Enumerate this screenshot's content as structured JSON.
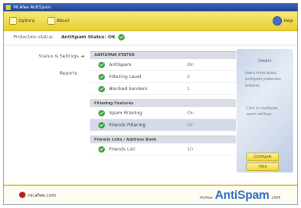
{
  "window": {
    "title": "McAfee AntiSpam"
  },
  "toolbar": {
    "items": [
      {
        "icon": "options-icon",
        "label": "Options"
      },
      {
        "icon": "about-icon",
        "label": "About"
      }
    ],
    "help_label": "Help"
  },
  "status": {
    "prefix": "Protection status:",
    "label": "AntiSpam Status: OK"
  },
  "nav": {
    "items": [
      {
        "label": "Status & Settings",
        "arrow": "◄"
      },
      {
        "label": "Reports"
      }
    ]
  },
  "sections": [
    {
      "title": "ANTISPAM STATUS",
      "rows": [
        {
          "label": "AntiSpam",
          "value": "On",
          "selected": false
        },
        {
          "label": "Filtering Level",
          "value": "2",
          "selected": false
        },
        {
          "label": "Blocked Senders",
          "value": "1",
          "selected": false
        }
      ]
    },
    {
      "title": "Filtering Features",
      "rows": [
        {
          "label": "Spam Filtering",
          "value": "On",
          "selected": false
        },
        {
          "label": "Friends Filtering",
          "value": "On",
          "selected": true
        }
      ]
    },
    {
      "title": "Friends Lists / Address Book",
      "rows": [
        {
          "label": "Friends List",
          "value": "10",
          "selected": false
        }
      ]
    }
  ],
  "sidebar": {
    "title": "Details",
    "text": "Learn more about AntiSpam protection features.",
    "text2": "Click to configure spam settings.",
    "buttons": [
      "Configure",
      "Help"
    ]
  },
  "footer": {
    "mcafee": "mcafee.com",
    "brand_pre": "McAfee",
    "brand_main": "AntiSpam",
    "brand_post": "2004"
  },
  "colors": {
    "accent_yellow": "#f0d632",
    "brand_blue": "#2f6ec6",
    "status_green": "#3aa23a"
  }
}
